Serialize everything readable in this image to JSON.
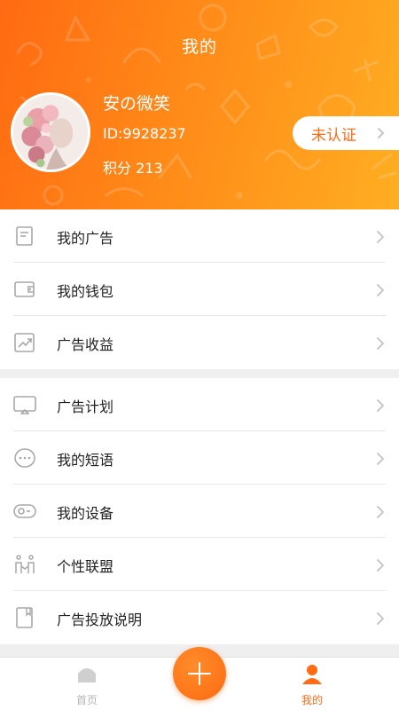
{
  "header": {
    "title": "我的",
    "username": "安の微笑",
    "user_id": "ID:9928237",
    "points": "积分 213",
    "cert_button": "未认证"
  },
  "menu_group_1": [
    {
      "label": "我的广告",
      "icon": "document-icon"
    },
    {
      "label": "我的钱包",
      "icon": "wallet-icon"
    },
    {
      "label": "广告收益",
      "icon": "trend-chart-icon"
    }
  ],
  "menu_group_2": [
    {
      "label": "广告计划",
      "icon": "monitor-icon"
    },
    {
      "label": "我的短语",
      "icon": "chat-bubble-icon"
    },
    {
      "label": "我的设备",
      "icon": "device-icon"
    },
    {
      "label": "个性联盟",
      "icon": "alliance-icon"
    },
    {
      "label": "广告投放说明",
      "icon": "book-icon"
    }
  ],
  "tabbar": {
    "home_label": "首页",
    "profile_label": "我的"
  },
  "colors": {
    "accent": "#ff6a12",
    "header_gradient_start": "#ff6a12",
    "header_gradient_end": "#ffae22",
    "inactive_tab": "#b5b5b5"
  }
}
